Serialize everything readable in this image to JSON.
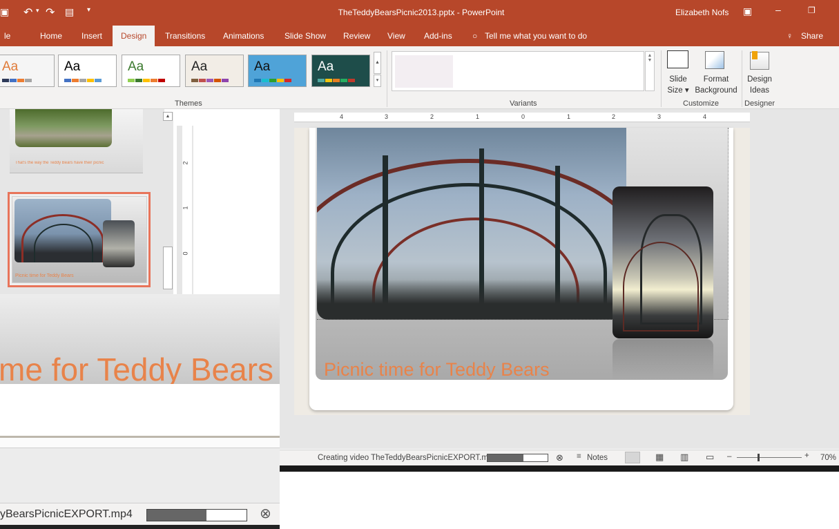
{
  "window": {
    "title": "TheTeddyBearsPicnic2013.pptx - PowerPoint",
    "user": "Elizabeth Nofs",
    "qat_icons": [
      "save-icon",
      "undo-icon",
      "redo-icon",
      "start-from-beginning-icon",
      "customize-qat-icon"
    ],
    "controls": [
      "ribbon-display-options-icon",
      "minimize-icon",
      "restore-icon"
    ]
  },
  "ribbon": {
    "tabs": [
      "le",
      "Home",
      "Insert",
      "Design",
      "Transitions",
      "Animations",
      "Slide Show",
      "Review",
      "View",
      "Add-ins"
    ],
    "active_tab": "Design",
    "tell_me": "Tell me what you want to do",
    "share": "Share",
    "themes": {
      "label": "Themes",
      "items": [
        {
          "aa": "Aa",
          "bg": "#f5f5f5",
          "fg": "#e07b39",
          "bars": [
            "#2e3a59",
            "#4472c4",
            "#ed7d31",
            "#a5a5a5"
          ]
        },
        {
          "aa": "Aa",
          "bg": "#ffffff",
          "fg": "#000000",
          "bars": [
            "#4472c4",
            "#ed7d31",
            "#a5a5a5",
            "#ffc000",
            "#5b9bd5"
          ]
        },
        {
          "aa": "Aa",
          "bg": "#ffffff",
          "fg": "#3c7a2f",
          "bars": [
            "#92d050",
            "#3c7a2f",
            "#ffc000",
            "#ed7d31",
            "#c00000"
          ]
        },
        {
          "aa": "Aa",
          "bg": "#f2ede6",
          "fg": "#222222",
          "bars": [
            "#7f5f3f",
            "#c0504d",
            "#9b59b6",
            "#d35400",
            "#8e44ad"
          ]
        },
        {
          "aa": "Aa",
          "bg": "#4fa3d8",
          "fg": "#111111",
          "bars": [
            "#1f77b4",
            "#17becf",
            "#2ca02c",
            "#ffbf00",
            "#d62728"
          ]
        },
        {
          "aa": "Aa",
          "bg": "#1e4d4a",
          "fg": "#ffffff",
          "bars": [
            "#4fa7a0",
            "#f1c40f",
            "#e67e22",
            "#27ae60",
            "#c0392b"
          ]
        }
      ]
    },
    "variants": {
      "label": "Variants"
    },
    "customize": {
      "label": "Customize",
      "slide_size": "Slide Size",
      "format_background": "Format Background"
    },
    "designer": {
      "label": "Designer",
      "design_ideas": "Design Ideas"
    }
  },
  "thumbnails": {
    "slide_a_caption": "That's the way the Teddy Bears have their picnic",
    "slide_b_caption": "Picnic time for Teddy Bears"
  },
  "rulers": {
    "horizontal": [
      "4",
      "3",
      "2",
      "1",
      "0",
      "1",
      "2",
      "3",
      "4"
    ],
    "vertical": [
      "2",
      "1",
      "0"
    ]
  },
  "slide": {
    "title": "Picnic time for Teddy Bears",
    "title_color": "#e8834a"
  },
  "statusbar": {
    "progress_text": "Creating video TheTeddyBearsPicnicEXPORT.mp4",
    "progress": 0.6,
    "notes": "Notes",
    "zoom": "70%"
  },
  "inset": {
    "title_fragment": "me for Teddy Bears",
    "progress_fragment": "yBearsPicnicEXPORT.mp4"
  }
}
